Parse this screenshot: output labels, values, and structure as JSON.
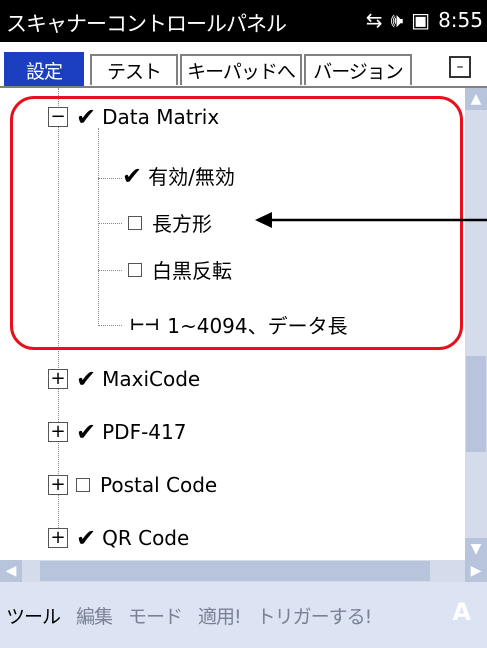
{
  "window": {
    "title": "スキャナーコントロールパネル",
    "clock": "8:55",
    "status_icons": [
      "connectivity-icon",
      "volume-icon",
      "battery-icon"
    ]
  },
  "tabs": [
    {
      "label": "設定",
      "active": true
    },
    {
      "label": "テスト",
      "active": false
    },
    {
      "label": "キーパッドへ",
      "active": false
    },
    {
      "label": "バージョン",
      "active": false
    }
  ],
  "minimize_label": "–",
  "tree": {
    "data_matrix": {
      "label": "Data Matrix",
      "expander": "−",
      "checked": true
    },
    "children": [
      {
        "label": "有効/無効",
        "checked": true
      },
      {
        "label": "長方形",
        "checked": false
      },
      {
        "label": "白黒反転",
        "checked": false
      },
      {
        "label": "1~4094、データ長",
        "type": "range"
      }
    ],
    "siblings": [
      {
        "label": "MaxiCode",
        "expander": "+",
        "checked": true
      },
      {
        "label": "PDF-417",
        "expander": "+",
        "checked": true
      },
      {
        "label": "Postal Code",
        "expander": "+",
        "checked": false
      },
      {
        "label": "QR Code",
        "expander": "+",
        "checked": true
      }
    ]
  },
  "menu": {
    "tools": "ツール",
    "edit": "編集",
    "mode": "モード",
    "apply": "適用!",
    "trigger": "トリガーする!",
    "keyboard": "A"
  },
  "colors": {
    "titlebar": "#000000",
    "active_tab": "#1b3fc0",
    "annotation": "#e8101c",
    "menubar": "#dce4f4"
  }
}
